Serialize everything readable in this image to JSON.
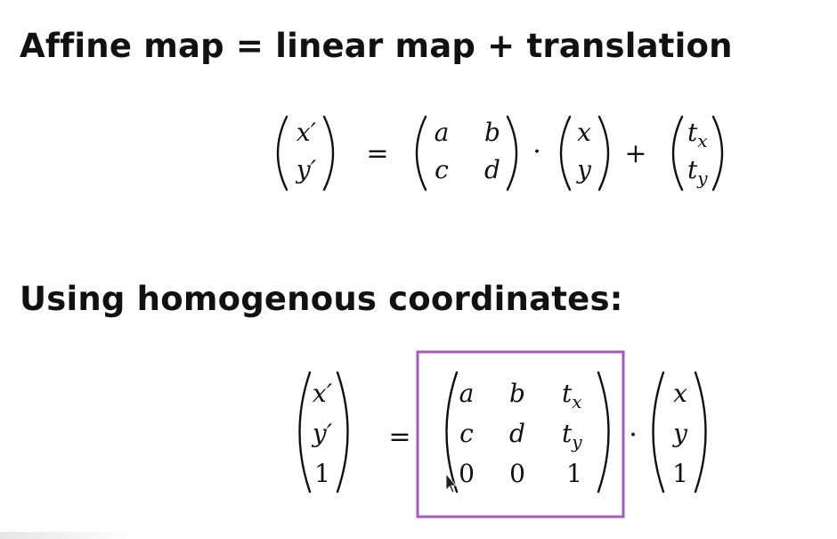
{
  "slide": {
    "heading_1": "Affine map = linear map + translation",
    "heading_2": "Using homogenous coordinates:"
  },
  "equation_1": {
    "lhs": [
      "x′",
      "y′"
    ],
    "equals": "=",
    "matrix": [
      [
        "a",
        "b"
      ],
      [
        "c",
        "d"
      ]
    ],
    "dot": "·",
    "vector": [
      "x",
      "y"
    ],
    "plus": "+",
    "translation": [
      [
        "t",
        "x"
      ],
      [
        "t",
        "y"
      ]
    ]
  },
  "equation_2": {
    "lhs": [
      "x′",
      "y′",
      "1"
    ],
    "equals": "=",
    "matrix": [
      [
        {
          "v": "a"
        },
        {
          "v": "b"
        },
        {
          "v": "t",
          "sub": "x"
        }
      ],
      [
        {
          "v": "c"
        },
        {
          "v": "d"
        },
        {
          "v": "t",
          "sub": "y"
        }
      ],
      [
        {
          "v": "0"
        },
        {
          "v": "0"
        },
        {
          "v": "1"
        }
      ]
    ],
    "dot": "·",
    "vector": [
      "x",
      "y",
      "1"
    ],
    "highlight_color": "#a45ab8"
  }
}
